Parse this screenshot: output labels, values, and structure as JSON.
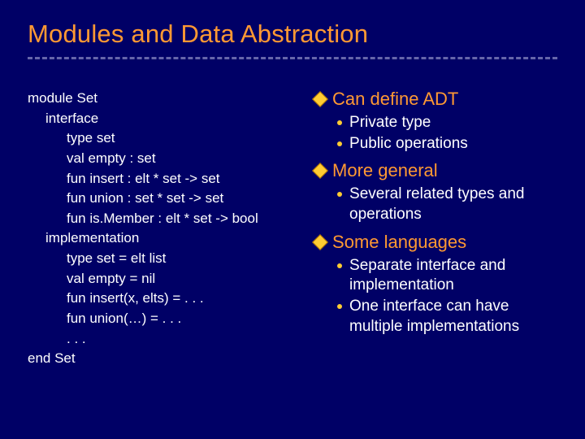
{
  "title": "Modules and Data Abstraction",
  "code": {
    "l0a": "module Set",
    "l1a": "interface",
    "l2a": "type set",
    "l2b": "val empty : set",
    "l2c": "fun insert : elt * set -> set",
    "l2d": "fun union : set * set -> set",
    "l2e": "fun is.Member : elt * set -> bool",
    "l1b": "implementation",
    "l2f": "type set = elt list",
    "l2g": "val empty = nil",
    "l2h": "fun insert(x, elts) = . . .",
    "l2i": "fun union(…) = . . .",
    "l2j": ". . .",
    "l0b": "end Set"
  },
  "points": {
    "p1": {
      "head": "Can define ADT",
      "b1": "Private type",
      "b2": "Public operations"
    },
    "p2": {
      "head": "More general",
      "b1": "Several related types and operations"
    },
    "p3": {
      "head": "Some languages",
      "b1": "Separate interface and implementation",
      "b2": "One interface can have multiple implementations"
    }
  }
}
